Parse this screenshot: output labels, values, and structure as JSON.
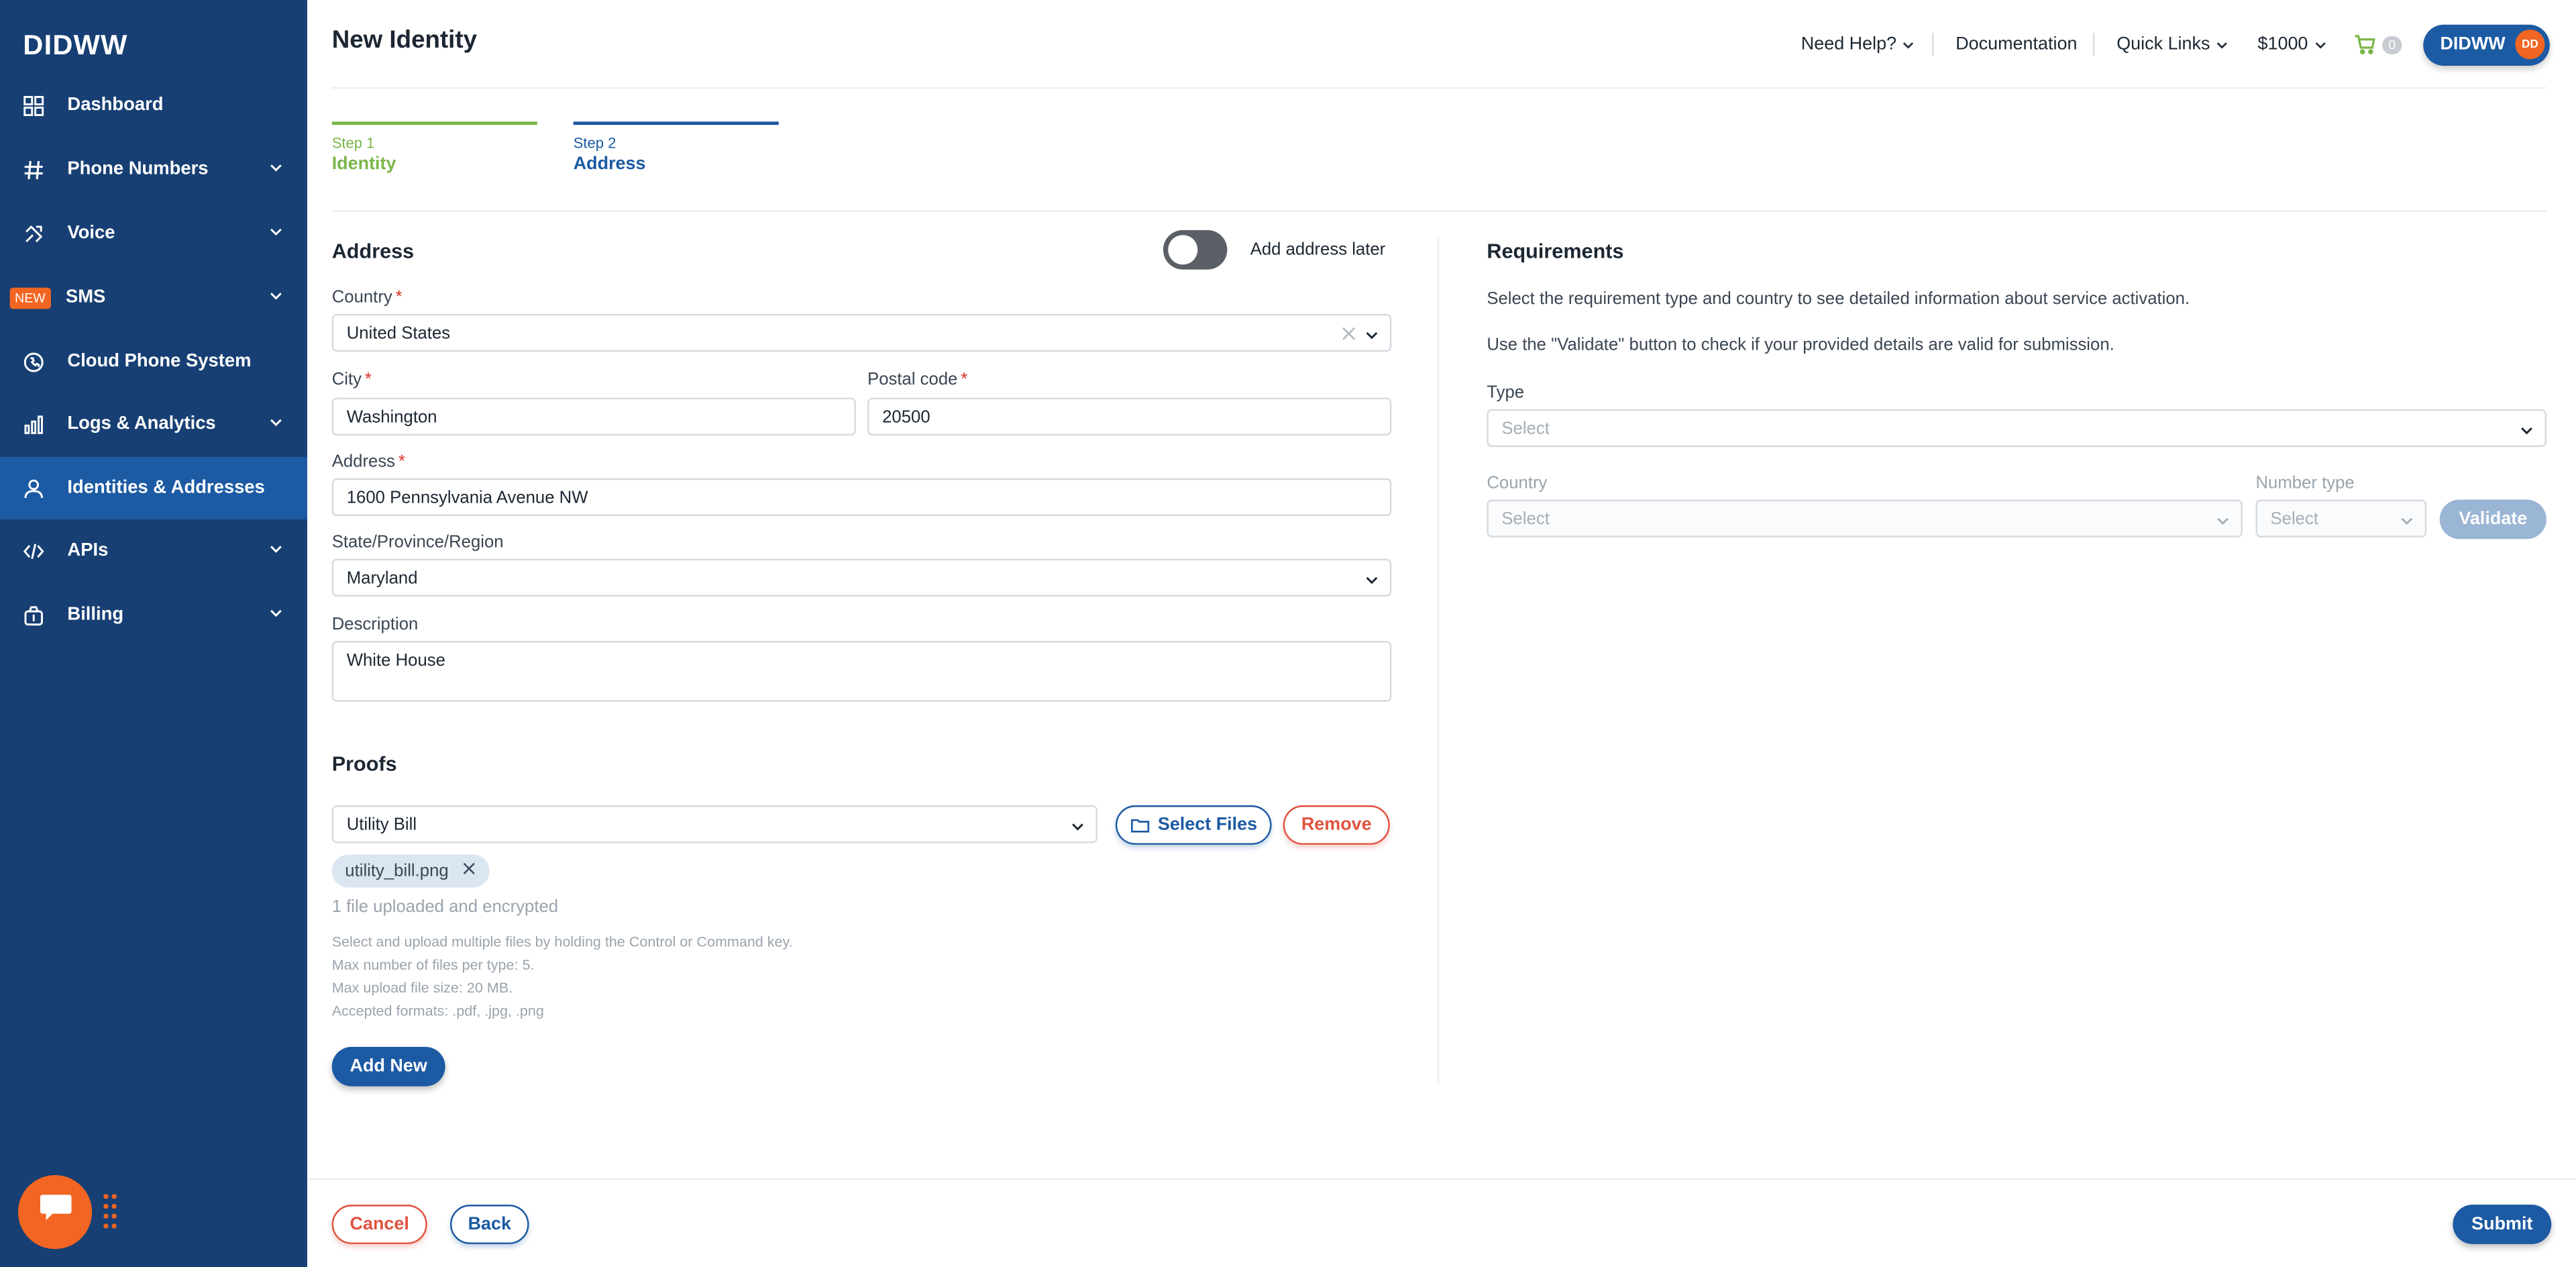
{
  "brand": "DIDWW",
  "sidebar": {
    "items": [
      {
        "label": "Dashboard",
        "icon": "dashboard-icon"
      },
      {
        "label": "Phone Numbers",
        "icon": "hash-icon"
      },
      {
        "label": "Voice",
        "icon": "phone-arrow-icon"
      },
      {
        "label": "SMS",
        "icon": "sms-icon",
        "badge": "NEW"
      },
      {
        "label": "Cloud Phone System",
        "icon": "cloud-phone-icon"
      },
      {
        "label": "Logs & Analytics",
        "icon": "bar-chart-icon"
      },
      {
        "label": "Identities & Addresses",
        "icon": "person-icon"
      },
      {
        "label": "APIs",
        "icon": "code-icon"
      },
      {
        "label": "Billing",
        "icon": "money-bag-icon"
      }
    ]
  },
  "header": {
    "title": "New Identity",
    "need_help": "Need Help?",
    "documentation": "Documentation",
    "quick_links": "Quick Links",
    "balance": "$1000",
    "cart_count": "0",
    "user": "DIDWW",
    "avatar_initials": "DD"
  },
  "steps": [
    {
      "num": "Step 1",
      "name": "Identity"
    },
    {
      "num": "Step 2",
      "name": "Address"
    }
  ],
  "address": {
    "heading": "Address",
    "toggle_label": "Add address later",
    "country_label": "Country",
    "country_value": "United States",
    "city_label": "City",
    "city_value": "Washington",
    "postal_label": "Postal code",
    "postal_value": "20500",
    "address_label": "Address",
    "address_value": "1600 Pennsylvania Avenue NW",
    "state_label": "State/Province/Region",
    "state_value": "Maryland",
    "description_label": "Description",
    "description_value": "White House"
  },
  "proofs": {
    "heading": "Proofs",
    "type_value": "Utility Bill",
    "select_files": "Select Files",
    "remove": "Remove",
    "file_chip": "utility_bill.png",
    "uploaded_status": "1 file uploaded and encrypted",
    "hints": [
      "Select and upload multiple files by holding the Control or Command key.",
      "Max number of files per type: 5.",
      "Max upload file size: 20 MB.",
      "Accepted formats: .pdf, .jpg, .png"
    ],
    "add_new": "Add New"
  },
  "requirements": {
    "heading": "Requirements",
    "line1": "Select the requirement type and country to see detailed information about service activation.",
    "line2": "Use the \"Validate\" button to check if your provided details are valid for submission.",
    "type_label": "Type",
    "type_placeholder": "Select",
    "country_label": "Country",
    "country_placeholder": "Select",
    "number_type_label": "Number type",
    "number_type_placeholder": "Select",
    "validate": "Validate"
  },
  "footer": {
    "cancel": "Cancel",
    "back": "Back",
    "submit": "Submit"
  },
  "colors": {
    "sidebar_bg": "#173f73",
    "sidebar_active": "#1c5aa3",
    "accent_blue": "#1c5aa3",
    "accent_orange": "#f26522",
    "step_done": "#7ab648",
    "danger": "#e0533f"
  }
}
